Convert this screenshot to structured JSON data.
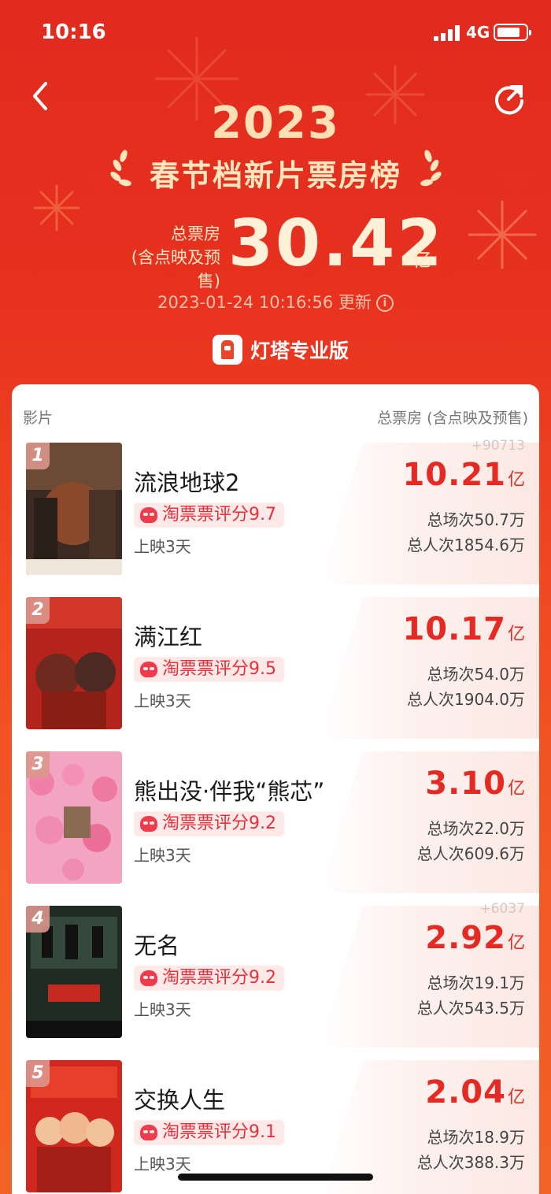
{
  "status_bar": {
    "time": "10:16",
    "network": "4G"
  },
  "header": {
    "year": "2023",
    "title": "春节档新片票房榜",
    "total_label_line1": "总票房",
    "total_label_line2": "(含点映及预售)",
    "total_value": "30.42",
    "total_unit": "亿",
    "update_time": "2023-01-24 10:16:56 更新",
    "info_glyph": "i",
    "brand": "灯塔专业版"
  },
  "table": {
    "col_left": "影片",
    "col_right": "总票房 (含点映及预售)"
  },
  "movies": [
    {
      "rank": "1",
      "title": "流浪地球2",
      "rating": "淘票票评分9.7",
      "days": "上映3天",
      "delta": "+90713",
      "gross": "10.21",
      "unit": "亿",
      "shows": "总场次50.7万",
      "viewers": "总人次1854.6万"
    },
    {
      "rank": "2",
      "title": "满江红",
      "rating": "淘票票评分9.5",
      "days": "上映3天",
      "delta": "",
      "gross": "10.17",
      "unit": "亿",
      "shows": "总场次54.0万",
      "viewers": "总人次1904.0万"
    },
    {
      "rank": "3",
      "title": "熊出没·伴我“熊芯”",
      "rating": "淘票票评分9.2",
      "days": "上映3天",
      "delta": "",
      "gross": "3.10",
      "unit": "亿",
      "shows": "总场次22.0万",
      "viewers": "总人次609.6万"
    },
    {
      "rank": "4",
      "title": "无名",
      "rating": "淘票票评分9.2",
      "days": "上映3天",
      "delta": "+6037",
      "gross": "2.92",
      "unit": "亿",
      "shows": "总场次19.1万",
      "viewers": "总人次543.5万"
    },
    {
      "rank": "5",
      "title": "交换人生",
      "rating": "淘票票评分9.1",
      "days": "上映3天",
      "delta": "",
      "gross": "2.04",
      "unit": "亿",
      "shows": "总场次18.9万",
      "viewers": "总人次388.3万"
    }
  ],
  "colors": {
    "accent": "#e42a22",
    "header_gold": "#fde6bd",
    "rating_bg": "#fde9e7"
  },
  "icons": {
    "back": "chevron-left-icon",
    "refresh": "share-refresh-icon",
    "laurel": "laurel-icon",
    "rating": "taopiaopiao-icon"
  }
}
